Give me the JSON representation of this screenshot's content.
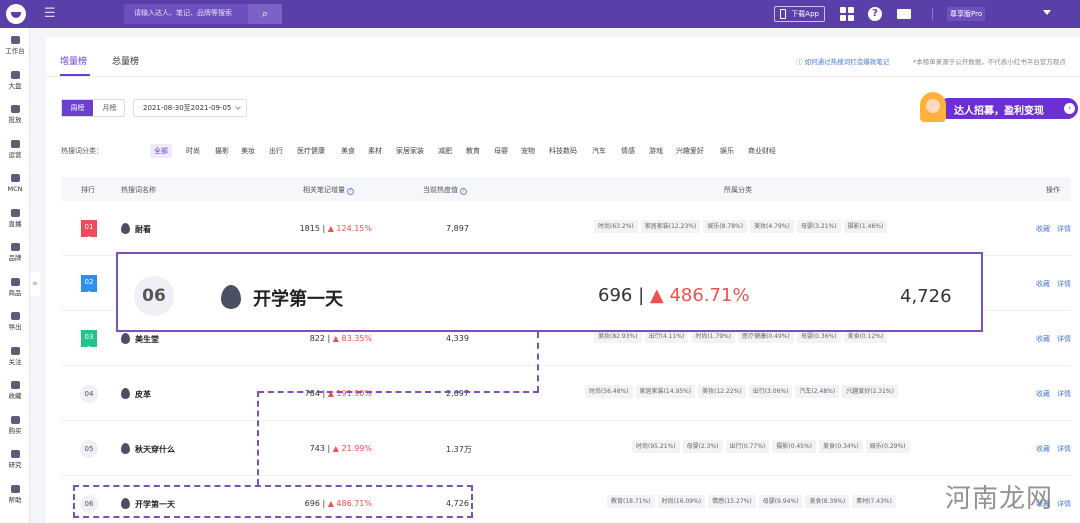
{
  "topbar": {
    "search_placeholder": "请输入达人、笔记、品牌等搜索",
    "download_app": "下载App",
    "help_icon": "?",
    "user": "尊享版Pro"
  },
  "sidebar": {
    "items": [
      {
        "label": "工作台",
        "icon": "dashboard-icon"
      },
      {
        "label": "大盘",
        "icon": "pie-icon"
      },
      {
        "label": "投放",
        "icon": "briefcase-icon"
      },
      {
        "label": "运营",
        "icon": "chat-icon"
      },
      {
        "label": "MCN",
        "icon": "building-icon"
      },
      {
        "label": "直播",
        "icon": "video-icon"
      },
      {
        "label": "品牌",
        "icon": "bag-icon"
      },
      {
        "label": "商品",
        "icon": "box-icon"
      },
      {
        "label": "导出",
        "icon": "export-icon"
      },
      {
        "label": "关注",
        "icon": "eye-icon"
      },
      {
        "label": "收藏",
        "icon": "heart-icon"
      },
      {
        "label": "购买",
        "icon": "cart-icon"
      },
      {
        "label": "研究",
        "icon": "flask-icon"
      },
      {
        "label": "帮助",
        "icon": "help-icon"
      }
    ],
    "expand": "»"
  },
  "tabs": [
    {
      "label": "增量榜",
      "active": true
    },
    {
      "label": "总量榜",
      "active": false
    }
  ],
  "how_link": "ⓘ 如何通过热搜词打造爆款笔记",
  "notice": "*本榜单来源于公开数据，不代表小红书平台官方观点",
  "period": {
    "on": "周榜",
    "off": "月榜"
  },
  "date_range": "2021-08-30至2021-09-05",
  "banner": {
    "text": "达人招募，盈利变现",
    "arrow": "›"
  },
  "categories": {
    "label": "热搜词分类：",
    "items": [
      "全部",
      "时尚",
      "摄影",
      "美妆",
      "出行",
      "医疗健康",
      "美食",
      "素材",
      "家居家装",
      "减肥",
      "教育",
      "母婴",
      "宠物",
      "科技数码",
      "汽车",
      "情感",
      "游戏",
      "兴趣爱好",
      "娱乐",
      "商业财经"
    ],
    "selected": "全部"
  },
  "table": {
    "headers": {
      "rank": "排行",
      "keyword": "热搜词名称",
      "increase": "相关笔记增量",
      "heat": "当前热度值",
      "category": "所属分类",
      "ops": "操作"
    },
    "ops": {
      "collect": "收藏",
      "detail": "详情"
    },
    "rows": [
      {
        "rank": "01",
        "keyword": "耐看",
        "increase": "1815",
        "pct": "124.15%",
        "heat": "7,897",
        "tags": [
          "时尚(63.2%)",
          "家居家装(12.23%)",
          "娱乐(8.78%)",
          "美妆(4.79%)",
          "母婴(3.21%)",
          "摄影(1.46%)"
        ]
      },
      {
        "rank": "02",
        "keyword": "",
        "increase": "",
        "pct": "",
        "heat": "",
        "tags": []
      },
      {
        "rank": "03",
        "keyword": "美生堂",
        "increase": "822",
        "pct": "83.35%",
        "heat": "4,339",
        "tags": [
          "美妆(82.93%)",
          "出行(4.11%)",
          "时尚(1.79%)",
          "医疗健康(0.49%)",
          "母婴(0.36%)",
          "美食(0.12%)"
        ]
      },
      {
        "rank": "04",
        "keyword": "皮革",
        "increase": "784",
        "pct": "191.90%",
        "heat": "2,697",
        "tags": [
          "时尚(56.48%)",
          "家居家装(14.95%)",
          "美妆(12.22%)",
          "出行(3.06%)",
          "汽车(2.48%)",
          "兴趣爱好(2.31%)"
        ]
      },
      {
        "rank": "05",
        "keyword": "秋天穿什么",
        "increase": "743",
        "pct": "21.99%",
        "heat": "1.37万",
        "tags": [
          "时尚(95.21%)",
          "母婴(2.3%)",
          "出行(0.77%)",
          "摄影(0.45%)",
          "美食(0.34%)",
          "娱乐(0.29%)"
        ]
      },
      {
        "rank": "06",
        "keyword": "开学第一天",
        "increase": "696",
        "pct": "486.71%",
        "heat": "4,726",
        "tags": [
          "教育(18.71%)",
          "时尚(16.09%)",
          "情感(15.27%)",
          "母婴(9.94%)",
          "美食(8.39%)",
          "素材(7.43%)"
        ]
      }
    ]
  },
  "zoom": {
    "rank": "06",
    "keyword": "开学第一天",
    "increase": "696 |",
    "pct": "486.71%",
    "heat": "4,726"
  },
  "watermark": "河南龙网",
  "colors": {
    "brand": "#5b3fa8",
    "accent": "#6b3fd0",
    "up": "#f0514f",
    "link": "#4a7bd6",
    "rank1": "#f04a5c",
    "rank2": "#2d8ff0",
    "rank3": "#25c28a"
  }
}
